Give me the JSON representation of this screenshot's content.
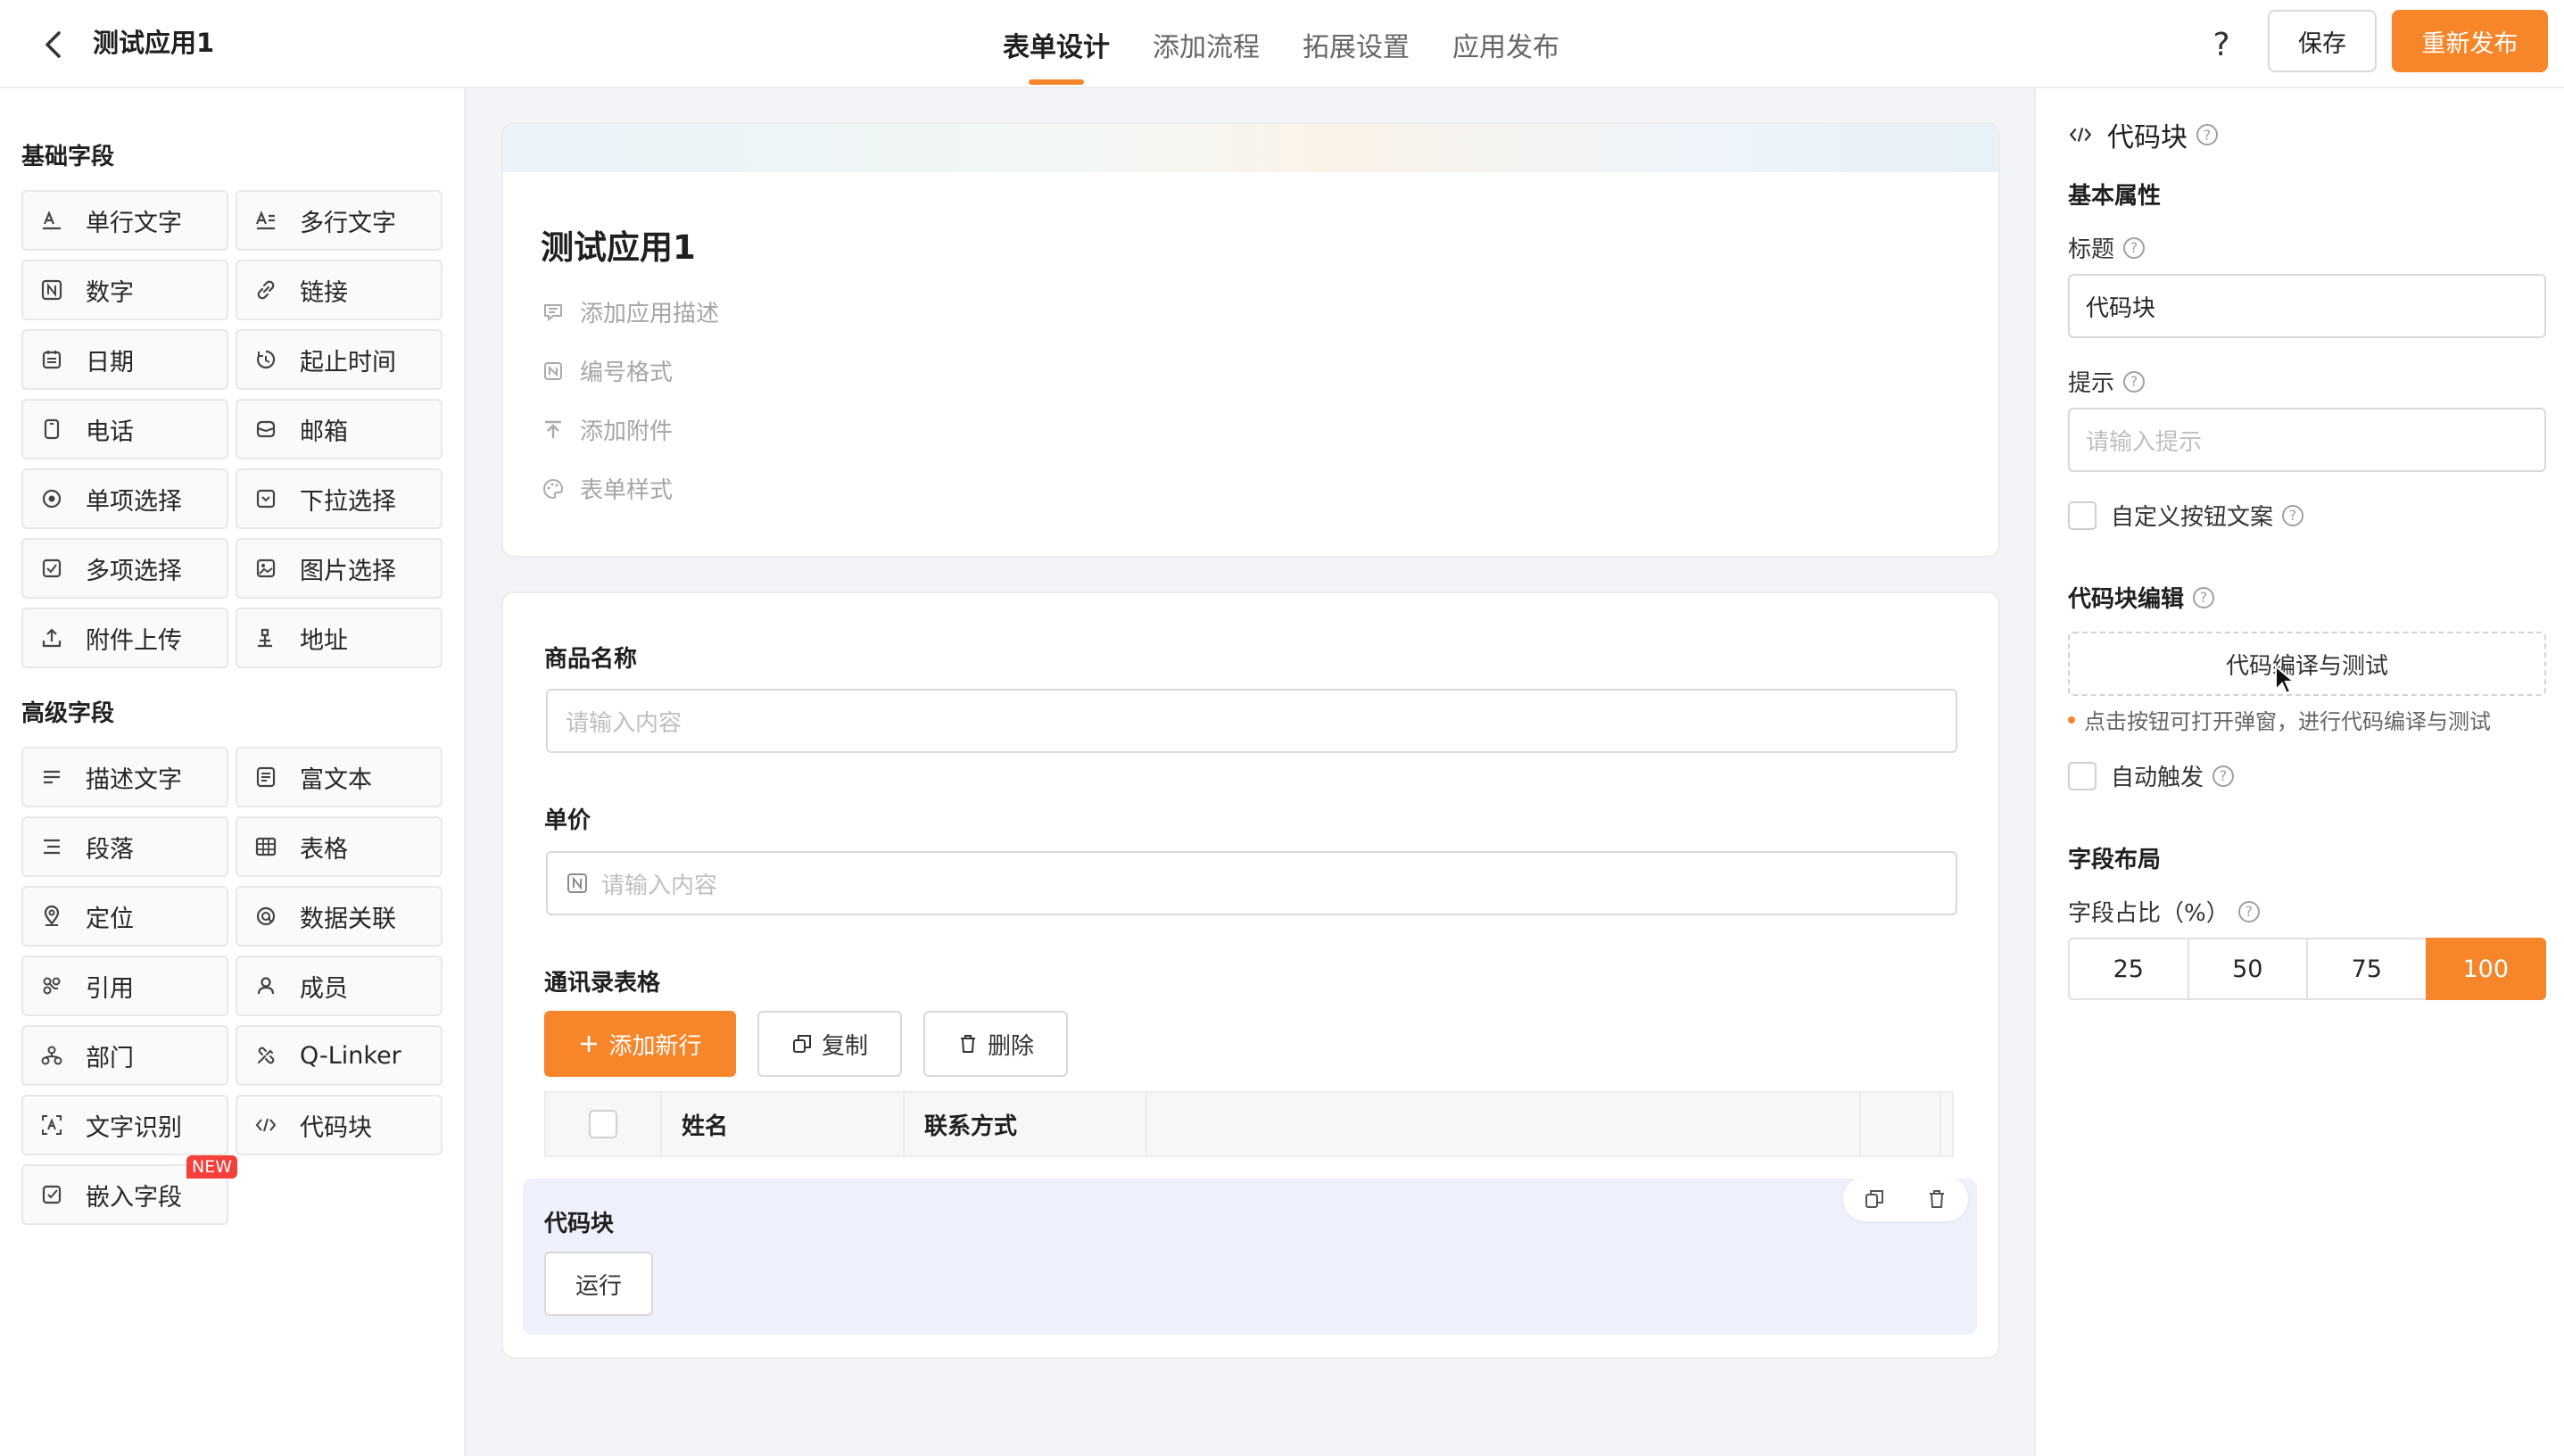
{
  "header": {
    "app_title": "测试应用1",
    "tabs": [
      {
        "label": "表单设计",
        "active": true
      },
      {
        "label": "添加流程",
        "active": false
      },
      {
        "label": "拓展设置",
        "active": false
      },
      {
        "label": "应用发布",
        "active": false
      }
    ],
    "help_label": "?",
    "save_label": "保存",
    "publish_label": "重新发布"
  },
  "left_panel": {
    "basic_title": "基础字段",
    "basic_fields": [
      {
        "label": "单行文字",
        "icon": "text-icon"
      },
      {
        "label": "多行文字",
        "icon": "multiline-text-icon"
      },
      {
        "label": "数字",
        "icon": "number-icon"
      },
      {
        "label": "链接",
        "icon": "link-icon"
      },
      {
        "label": "日期",
        "icon": "calendar-icon"
      },
      {
        "label": "起止时间",
        "icon": "time-range-icon"
      },
      {
        "label": "电话",
        "icon": "phone-icon"
      },
      {
        "label": "邮箱",
        "icon": "mail-icon"
      },
      {
        "label": "单项选择",
        "icon": "radio-icon"
      },
      {
        "label": "下拉选择",
        "icon": "dropdown-icon"
      },
      {
        "label": "多项选择",
        "icon": "checkbox-icon"
      },
      {
        "label": "图片选择",
        "icon": "image-icon"
      },
      {
        "label": "附件上传",
        "icon": "upload-icon"
      },
      {
        "label": "地址",
        "icon": "address-icon"
      }
    ],
    "advanced_title": "高级字段",
    "advanced_fields": [
      {
        "label": "描述文字",
        "icon": "description-icon"
      },
      {
        "label": "富文本",
        "icon": "rich-text-icon"
      },
      {
        "label": "段落",
        "icon": "paragraph-icon"
      },
      {
        "label": "表格",
        "icon": "table-icon"
      },
      {
        "label": "定位",
        "icon": "location-icon"
      },
      {
        "label": "数据关联",
        "icon": "data-link-icon"
      },
      {
        "label": "引用",
        "icon": "reference-icon"
      },
      {
        "label": "成员",
        "icon": "member-icon"
      },
      {
        "label": "部门",
        "icon": "department-icon"
      },
      {
        "label": "Q-Linker",
        "icon": "qlinker-icon"
      },
      {
        "label": "文字识别",
        "icon": "ocr-icon"
      },
      {
        "label": "代码块",
        "icon": "code-icon"
      },
      {
        "label": "嵌入字段",
        "icon": "embed-icon",
        "badge": "NEW"
      }
    ]
  },
  "form": {
    "title": "测试应用1",
    "meta": [
      {
        "label": "添加应用描述",
        "icon": "comment-icon"
      },
      {
        "label": "编号格式",
        "icon": "number-format-icon"
      },
      {
        "label": "添加附件",
        "icon": "attach-upload-icon"
      },
      {
        "label": "表单样式",
        "icon": "palette-icon"
      }
    ],
    "product_name_label": "商品名称",
    "product_name_placeholder": "请输入内容",
    "unit_price_label": "单价",
    "unit_price_placeholder": "请输入内容",
    "contacts_table_label": "通讯录表格",
    "add_row_label": "添加新行",
    "copy_label": "复制",
    "delete_label": "删除",
    "table_columns": [
      "姓名",
      "联系方式"
    ],
    "code_block_label": "代码块",
    "run_label": "运行"
  },
  "right_panel": {
    "title": "代码块",
    "basic_props_title": "基本属性",
    "title_label": "标题",
    "title_value": "代码块",
    "hint_label": "提示",
    "hint_placeholder": "请输入提示",
    "custom_button_text_label": "自定义按钮文案",
    "code_edit_title": "代码块编辑",
    "code_compile_button": "代码编译与测试",
    "code_hint": "点击按钮可打开弹窗，进行代码编译与测试",
    "auto_trigger_label": "自动触发",
    "layout_title": "字段布局",
    "ratio_label": "字段占比（%）",
    "ratio_options": [
      "25",
      "50",
      "75",
      "100"
    ],
    "ratio_selected": "100"
  },
  "colors": {
    "accent": "#f7862a",
    "badge": "#f5403a",
    "canvas_bg": "#f3f4f7",
    "selected_block_bg": "#eef0fb"
  }
}
